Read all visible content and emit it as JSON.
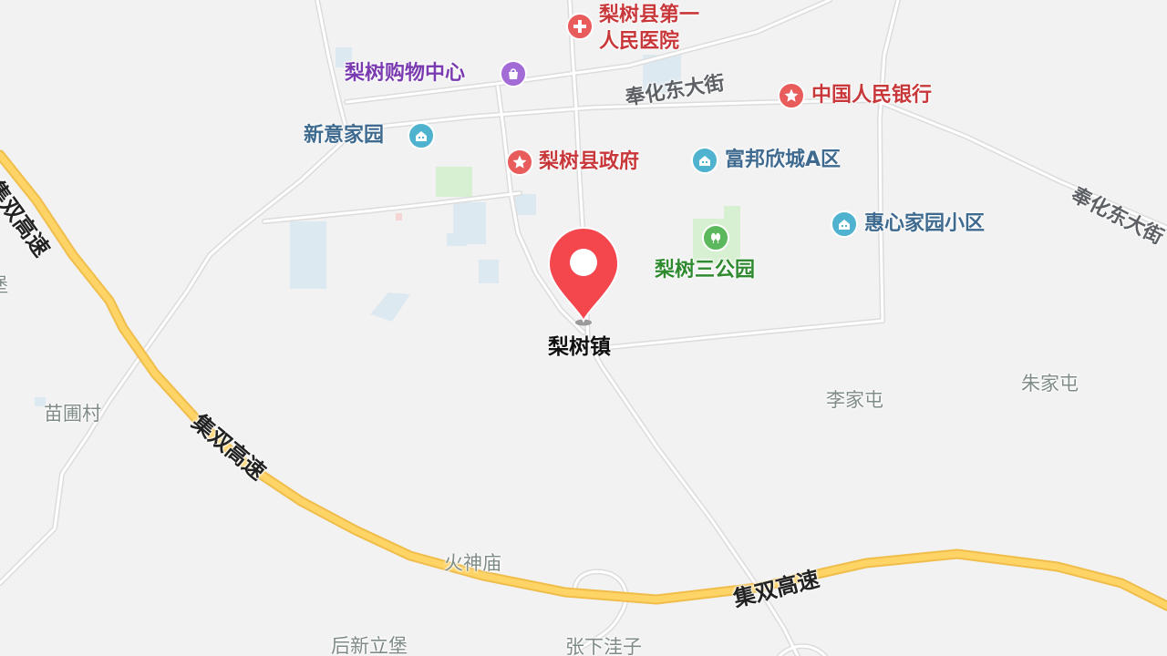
{
  "map": {
    "center": {
      "label": "梨树镇",
      "icon": "location-pin-icon"
    },
    "pois": [
      {
        "id": "hospital",
        "label_lines": [
          "梨树县第一",
          "人民医院"
        ],
        "icon": "hospital-icon",
        "color": "#e85c5c"
      },
      {
        "id": "shopping",
        "label": "梨树购物中心",
        "icon": "shopping-bag-icon",
        "color": "#a26bd6"
      },
      {
        "id": "bank",
        "label": "中国人民银行",
        "icon": "star-icon",
        "color": "#e85c5c"
      },
      {
        "id": "xinyi",
        "label": "新意家园",
        "icon": "residence-icon",
        "color": "#4fb3cf"
      },
      {
        "id": "gov",
        "label": "梨树县政府",
        "icon": "star-icon",
        "color": "#e85c5c"
      },
      {
        "id": "fubang",
        "label": "富邦欣城A区",
        "icon": "residence-icon",
        "color": "#4fb3cf"
      },
      {
        "id": "huixin",
        "label": "惠心家园小区",
        "icon": "residence-icon",
        "color": "#4fb3cf"
      },
      {
        "id": "park",
        "label": "梨树三公园",
        "icon": "park-tree-icon",
        "color": "#5cb85c"
      }
    ],
    "roads": {
      "fenghua_1": "奉化东大街",
      "fenghua_2": "奉化东大街",
      "highway_1": "集双高速",
      "highway_2": "集双高速",
      "highway_3": "集双高速"
    },
    "places": {
      "miaopu": "苗圃村",
      "lijia": "李家屯",
      "zhujia": "朱家屯",
      "huoshen": "火神庙",
      "houxin": "后新立堡",
      "zhangxia": "张下洼子",
      "edge_left": "堡"
    }
  }
}
